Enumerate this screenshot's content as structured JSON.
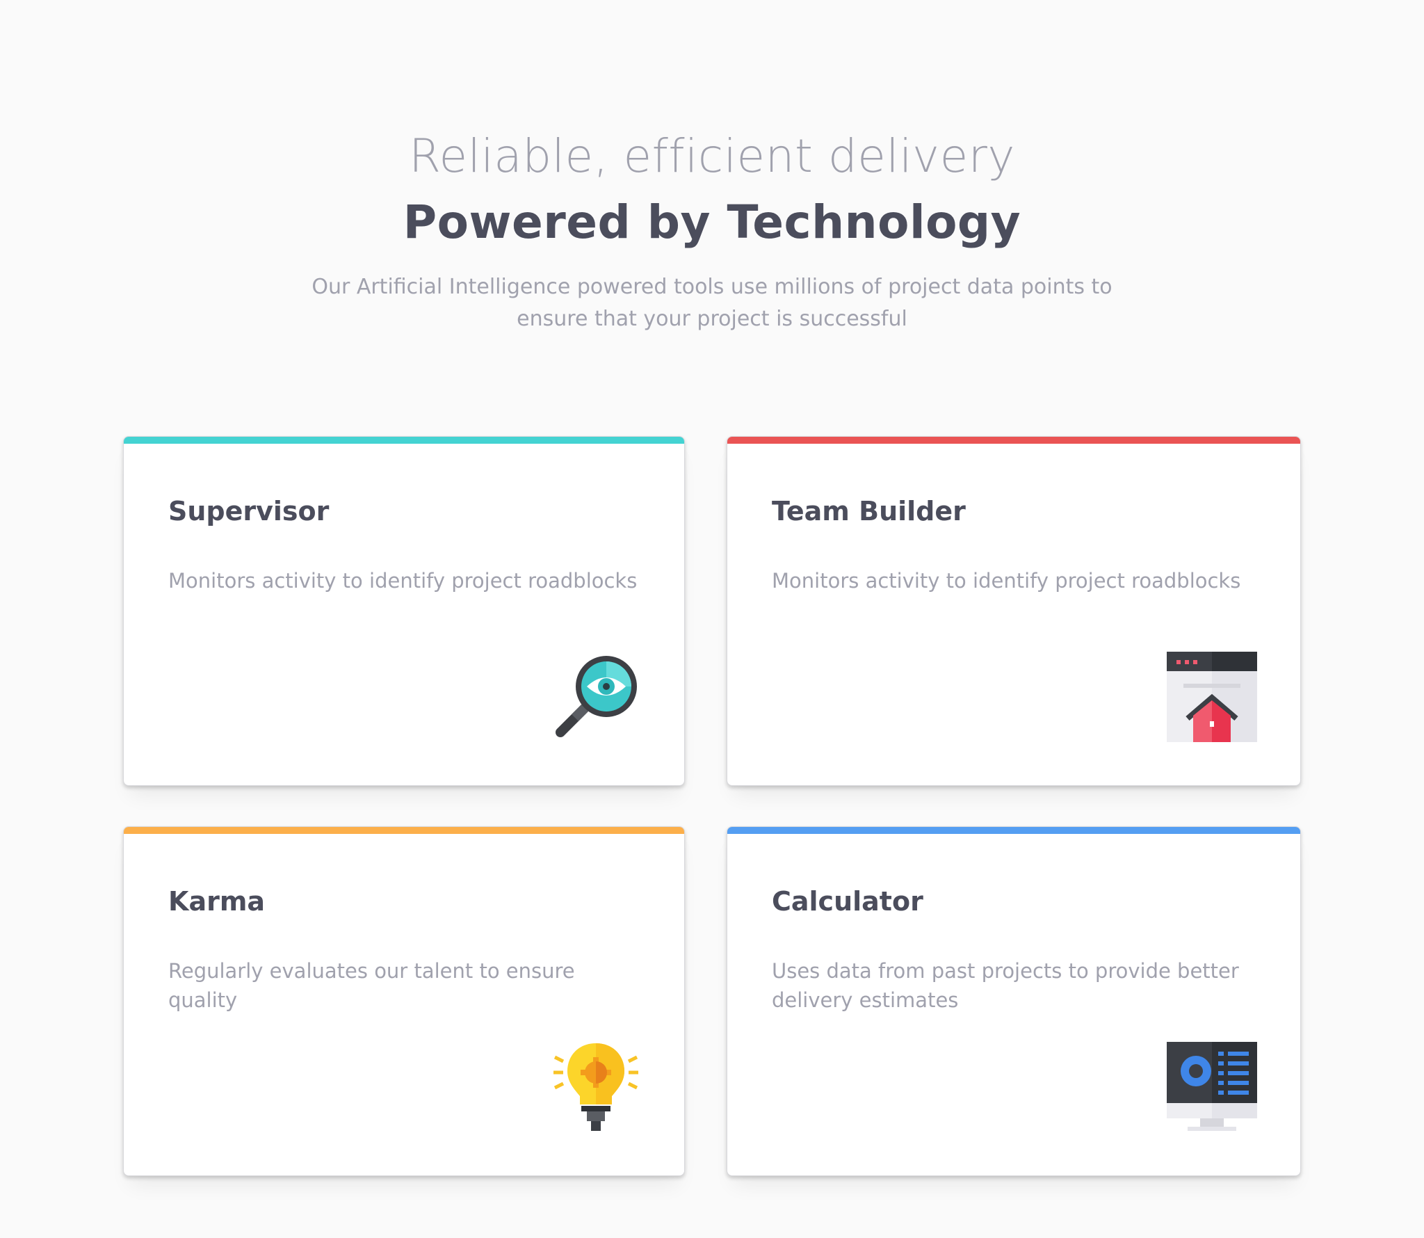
{
  "header": {
    "eyebrow": "Reliable, efficient delivery",
    "title": "Powered by Technology",
    "subtitle": "Our Artificial Intelligence powered tools use millions of project data points to ensure that your project is successful"
  },
  "cards": [
    {
      "title": "Supervisor",
      "description": "Monitors activity to identify project roadblocks",
      "accent_color": "#44d3d2",
      "icon": "magnifier-eye-icon"
    },
    {
      "title": "Team Builder",
      "description": "Monitors activity to identify project roadblocks",
      "accent_color": "#ea5454",
      "icon": "browser-house-icon"
    },
    {
      "title": "Karma",
      "description": "Regularly evaluates our talent to ensure quality",
      "accent_color": "#fcaf4a",
      "icon": "lightbulb-gear-icon"
    },
    {
      "title": "Calculator",
      "description": "Uses data from past projects to provide better delivery estimates",
      "accent_color": "#549ef2",
      "icon": "monitor-dashboard-icon"
    }
  ]
}
